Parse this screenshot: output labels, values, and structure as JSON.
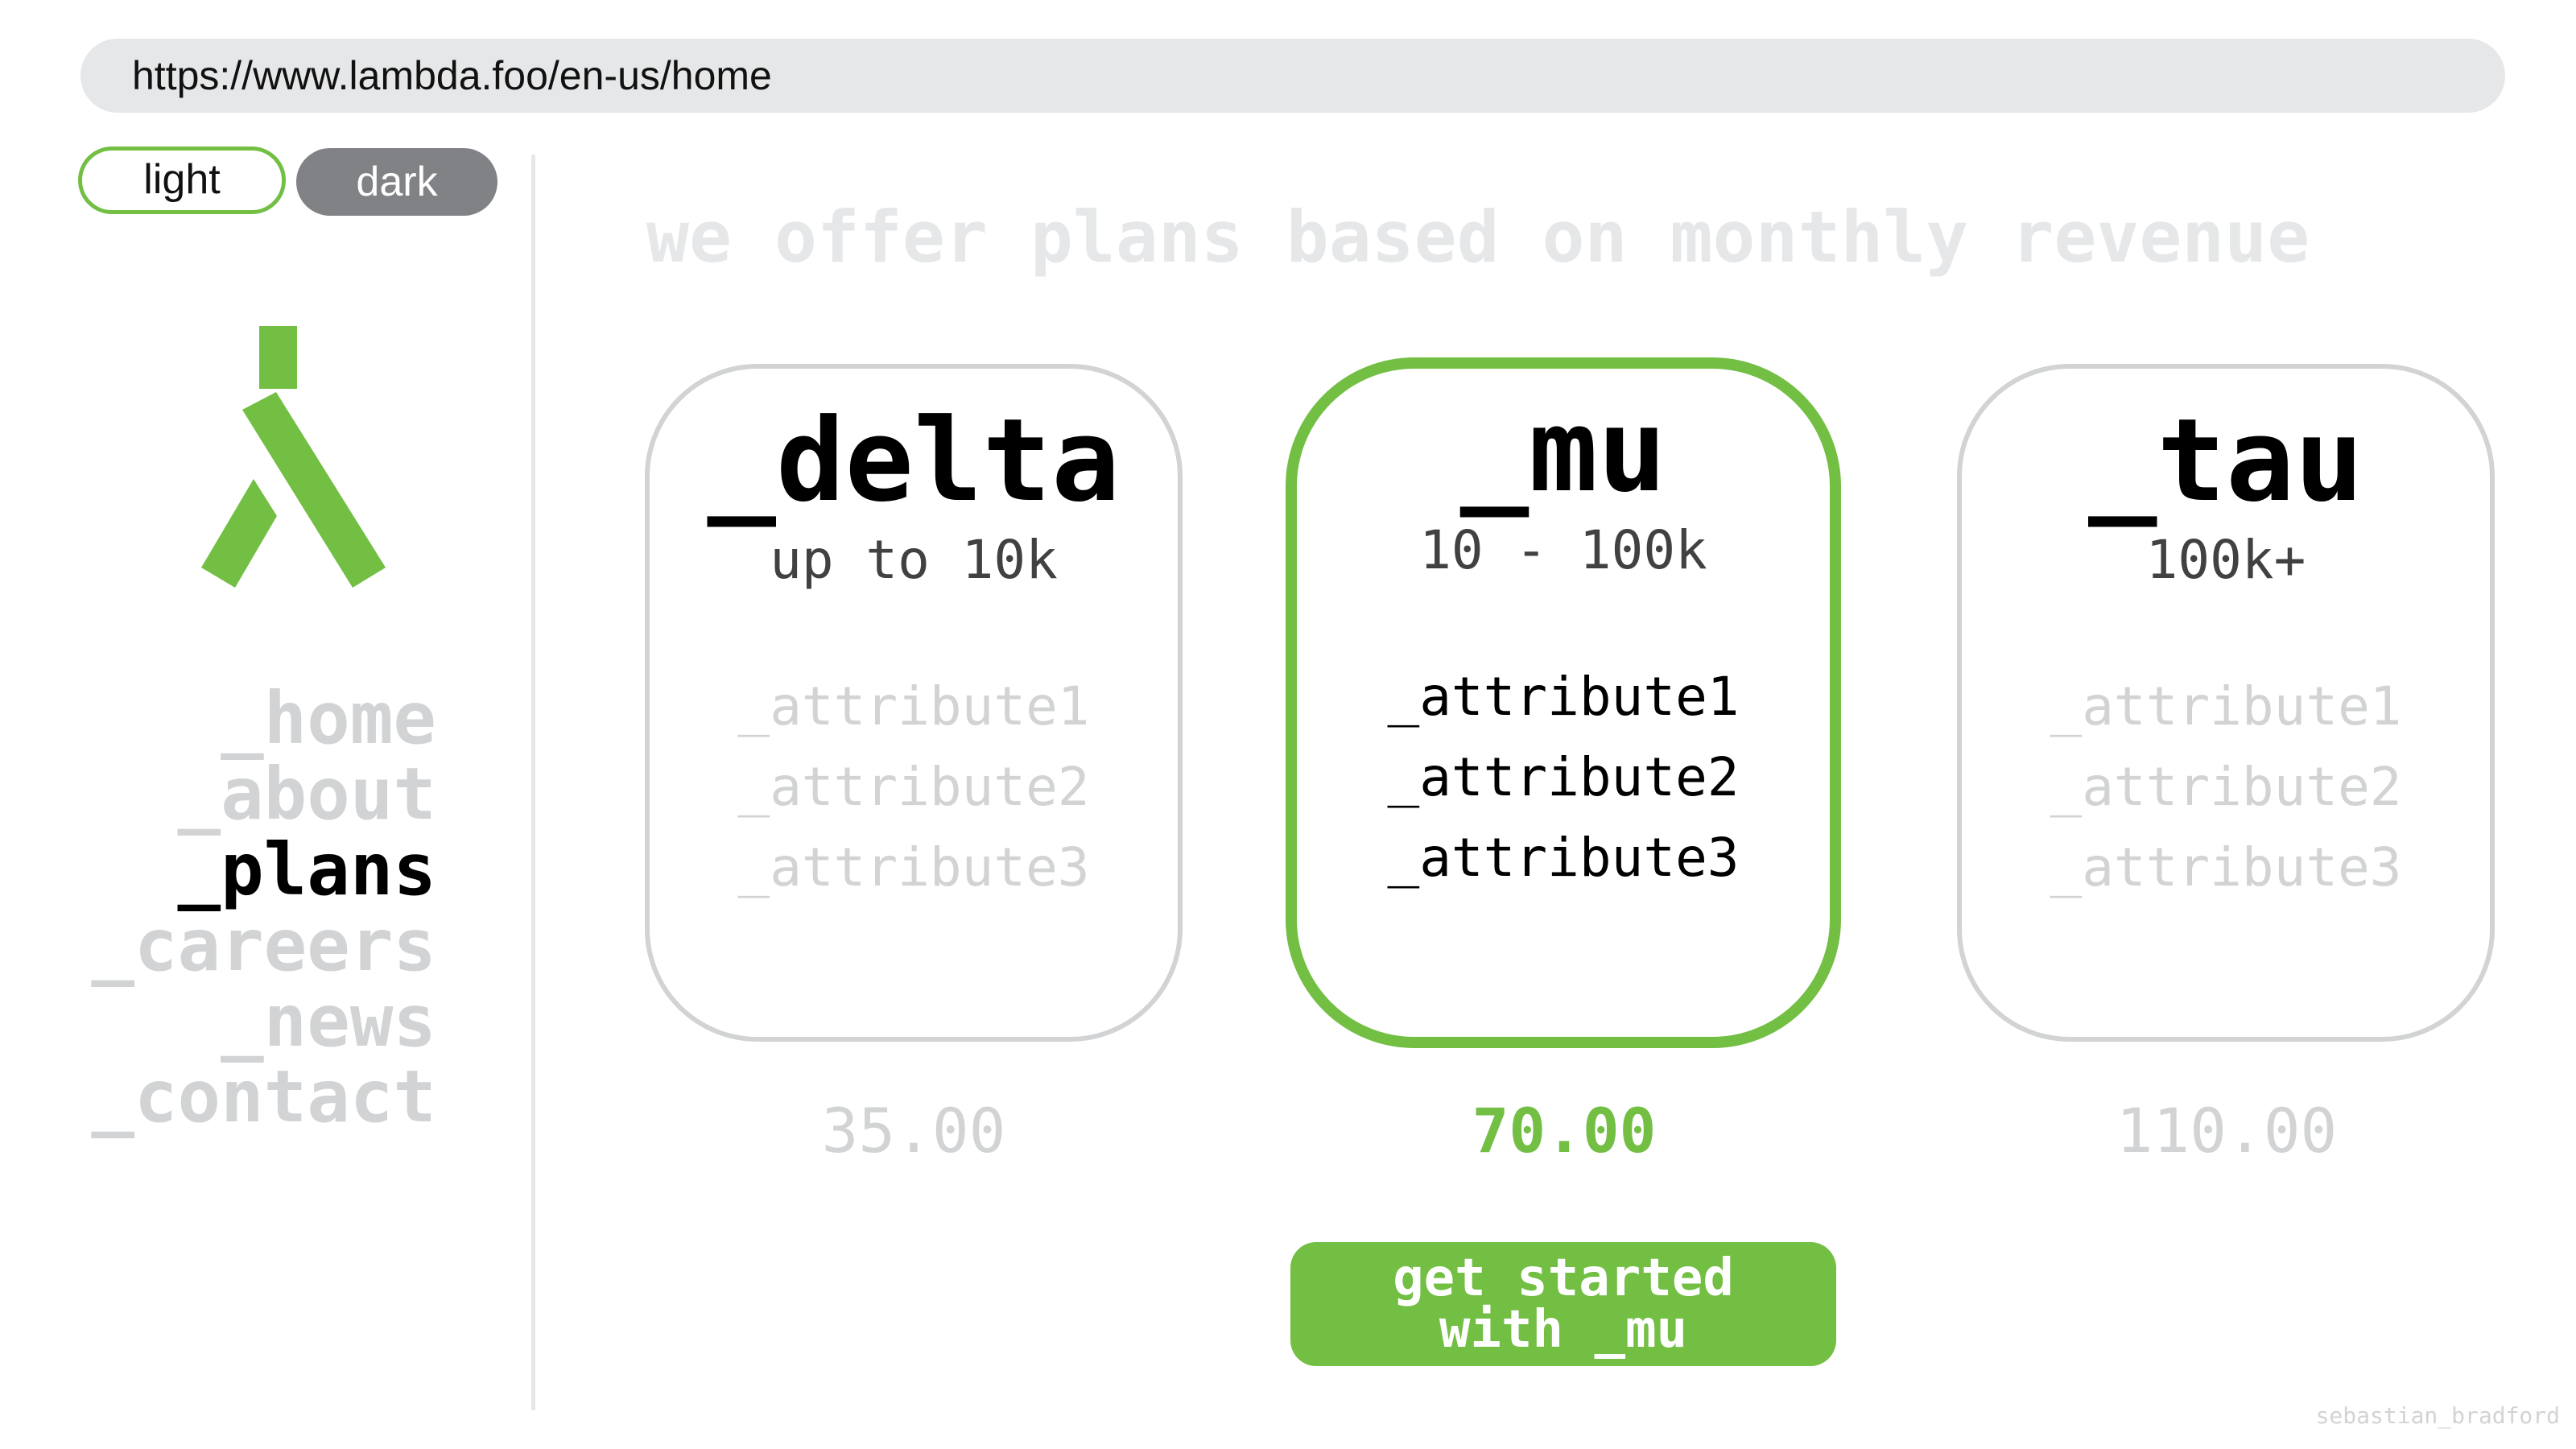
{
  "browser": {
    "url": "https://www.lambda.foo/en-us/home"
  },
  "theme_toggle": {
    "light_label": "light",
    "dark_label": "dark"
  },
  "logo": {
    "icon": "lambda-logo-icon",
    "color": "#72bf44"
  },
  "nav": {
    "items": [
      {
        "label": "_home",
        "active": false
      },
      {
        "label": "_about",
        "active": false
      },
      {
        "label": "_plans",
        "active": true
      },
      {
        "label": "_careers",
        "active": false
      },
      {
        "label": "_news",
        "active": false
      },
      {
        "label": "_contact",
        "active": false
      }
    ]
  },
  "headline": "we offer plans based on monthly revenue",
  "plans": [
    {
      "name": "_delta",
      "range": "up to 10k",
      "attributes": [
        "_attribute1",
        "_attribute2",
        "_attribute3"
      ],
      "price": "35.00",
      "selected": false
    },
    {
      "name": "_mu",
      "range": "10 - 100k",
      "attributes": [
        "_attribute1",
        "_attribute2",
        "_attribute3"
      ],
      "price": "70.00",
      "selected": true
    },
    {
      "name": "_tau",
      "range": "100k+",
      "attributes": [
        "_attribute1",
        "_attribute2",
        "_attribute3"
      ],
      "price": "110.00",
      "selected": false
    }
  ],
  "cta": {
    "label": "get started with _mu"
  },
  "credit": "sebastian_bradford",
  "colors": {
    "accent": "#72bf44",
    "muted": "#d1d3d4",
    "urlbar": "#e6e7e8",
    "toggle_dark": "#808285"
  }
}
